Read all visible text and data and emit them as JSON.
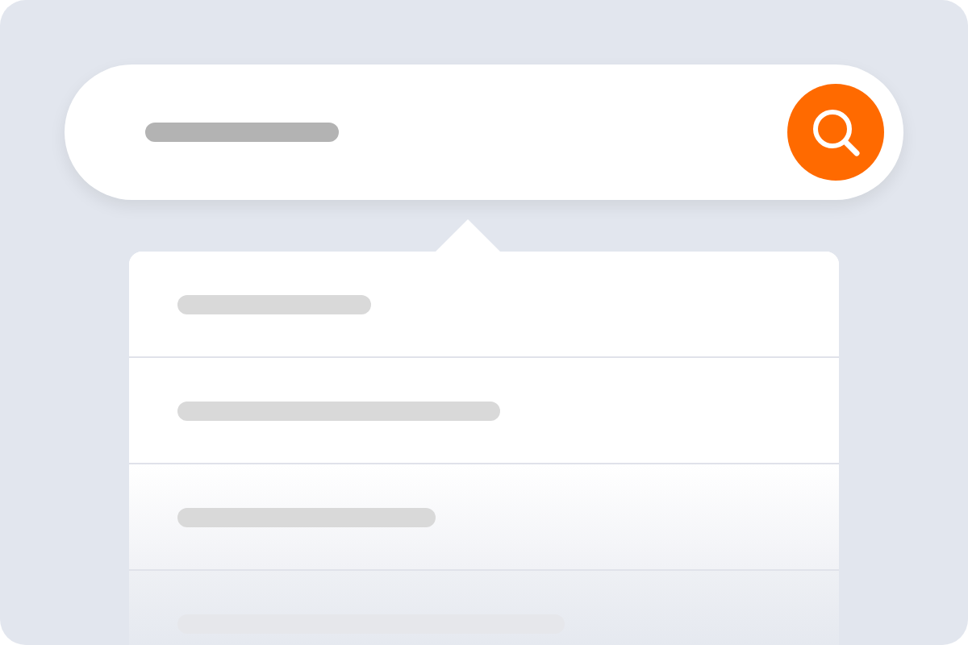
{
  "search_field": {
    "kind": "placeholder-line"
  },
  "suggestions": [
    {
      "kind": "plain"
    },
    {
      "kind": "plain"
    },
    {
      "kind": "fading"
    },
    {
      "kind": "faded"
    }
  ]
}
